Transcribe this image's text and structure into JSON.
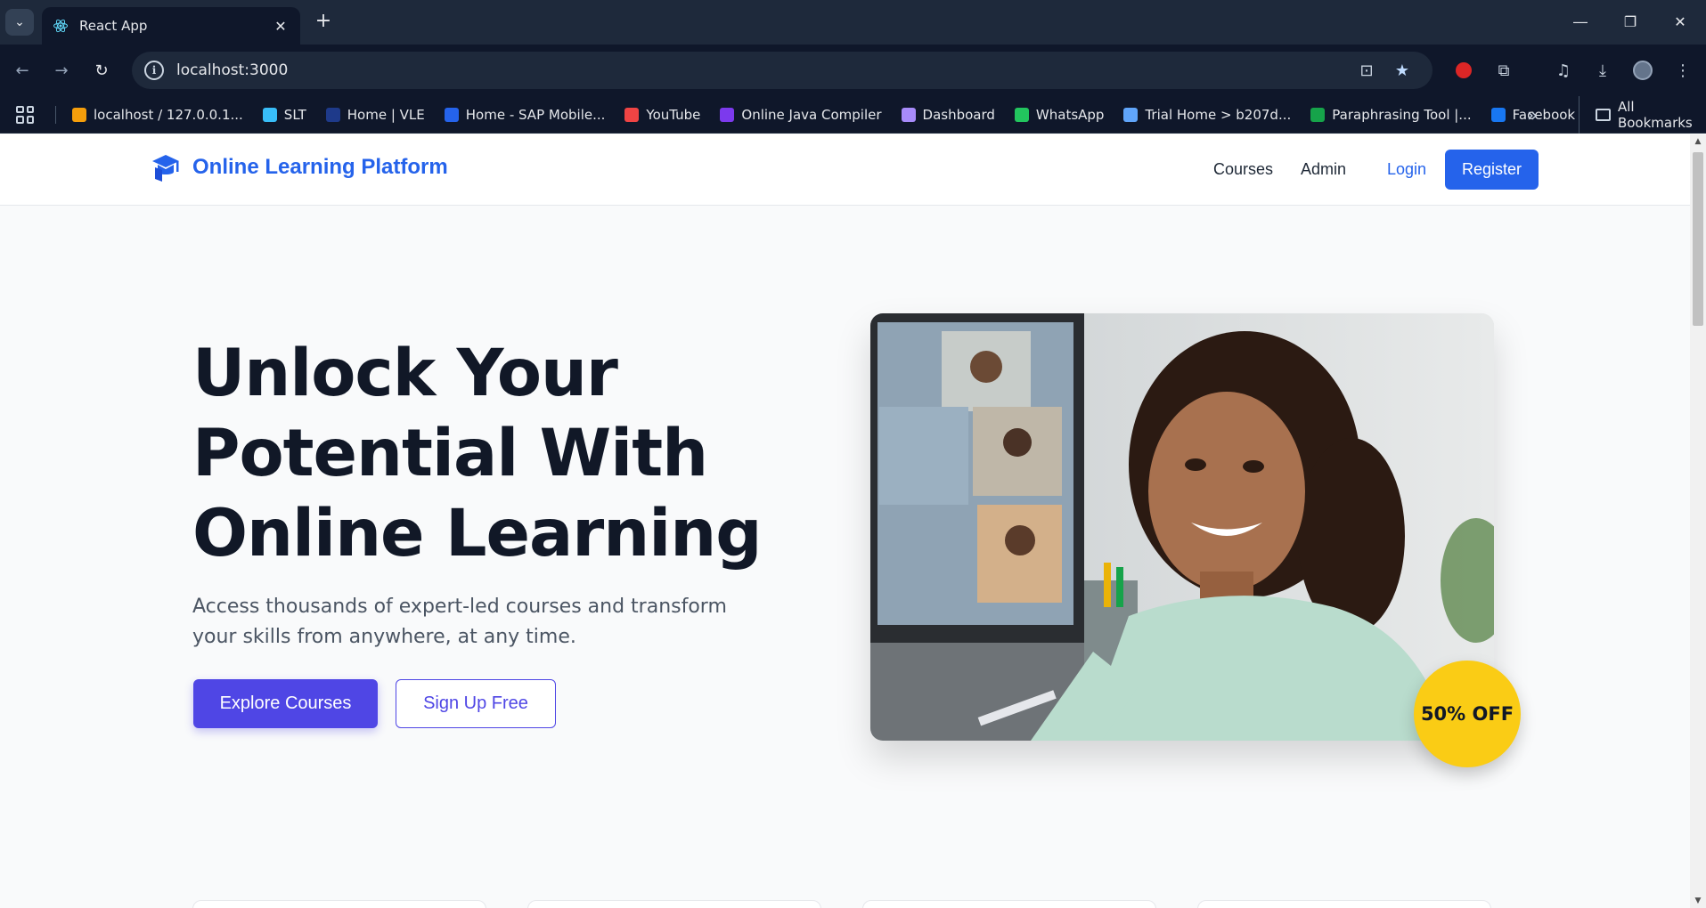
{
  "browser": {
    "tab_title": "React App",
    "url": "localhost:3000",
    "bookmarks": [
      {
        "label": "localhost / 127.0.0.1...",
        "color": "#f59e0b"
      },
      {
        "label": "SLT",
        "color": "#38bdf8"
      },
      {
        "label": "Home | VLE",
        "color": "#1e3a8a"
      },
      {
        "label": "Home - SAP Mobile...",
        "color": "#2563eb"
      },
      {
        "label": "YouTube",
        "color": "#ef4444"
      },
      {
        "label": "Online Java Compiler",
        "color": "#7c3aed"
      },
      {
        "label": "Dashboard",
        "color": "#a78bfa"
      },
      {
        "label": "WhatsApp",
        "color": "#22c55e"
      },
      {
        "label": "Trial Home > b207d...",
        "color": "#60a5fa"
      },
      {
        "label": "Paraphrasing Tool |...",
        "color": "#16a34a"
      },
      {
        "label": "Facebook",
        "color": "#1877f2"
      }
    ],
    "all_bookmarks_label": "All Bookmarks"
  },
  "navbar": {
    "brand": "Online Learning Platform",
    "links": {
      "courses": "Courses",
      "admin": "Admin",
      "login": "Login"
    },
    "register": "Register"
  },
  "hero": {
    "title_lines": [
      "Unlock Your",
      "Potential With",
      "Online Learning"
    ],
    "subtitle": "Access thousands of expert-led courses and transform your skills from anywhere, at any time.",
    "primary_cta": "Explore Courses",
    "secondary_cta": "Sign Up Free",
    "badge": "50% OFF"
  },
  "colors": {
    "brand_blue": "#2563eb",
    "cta_indigo": "#4f46e5",
    "badge_yellow": "#facc15"
  }
}
